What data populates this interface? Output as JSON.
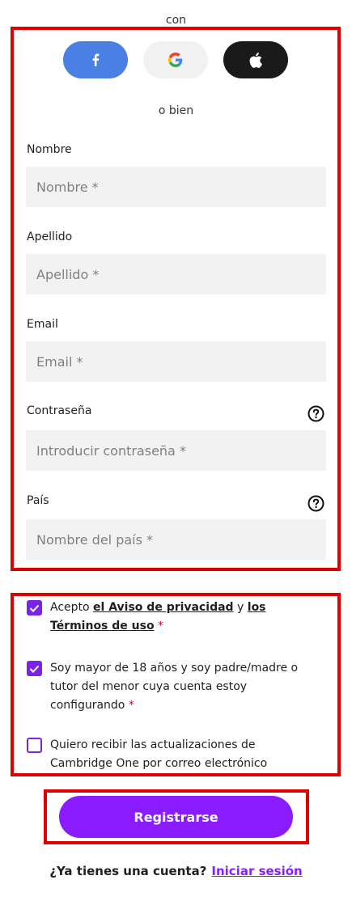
{
  "header": {
    "con": "con"
  },
  "social": {
    "facebook_icon": "facebook-icon",
    "google_icon": "google-icon",
    "apple_icon": "apple-icon"
  },
  "divider": "o bien",
  "form": {
    "nombre": {
      "label": "Nombre",
      "placeholder": "Nombre *",
      "value": ""
    },
    "apellido": {
      "label": "Apellido",
      "placeholder": "Apellido *",
      "value": ""
    },
    "email": {
      "label": "Email",
      "placeholder": "Email *",
      "value": ""
    },
    "password": {
      "label": "Contraseña",
      "placeholder": "Introducir contraseña *",
      "value": ""
    },
    "pais": {
      "label": "País",
      "placeholder": "Nombre del país *",
      "value": ""
    }
  },
  "consents": {
    "terms": {
      "checked": true,
      "text_a": "Acepto ",
      "link_privacy": "el Aviso de privacidad",
      "text_b": " y ",
      "link_terms": "los Términos de uso",
      "required": " *"
    },
    "age": {
      "checked": true,
      "text": "Soy mayor de 18 años y soy padre/madre o tutor del menor cuya cuenta estoy configurando",
      "required": " *"
    },
    "newsletter": {
      "checked": false,
      "text": "Quiero recibir las actualizaciones de Cambridge One por correo electrónico"
    }
  },
  "submit": {
    "label": "Registrarse"
  },
  "footer": {
    "question": "¿Ya tienes una cuenta?",
    "login_link": "Iniciar sesión"
  },
  "colors": {
    "accent": "#8a1cff",
    "facebook": "#4a7fe4",
    "highlight_box": "#e00000"
  }
}
